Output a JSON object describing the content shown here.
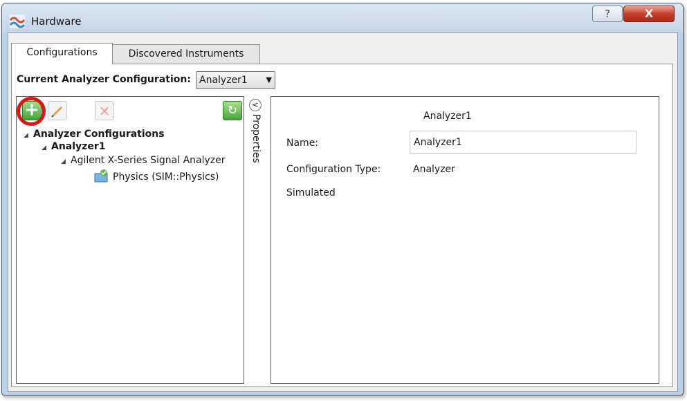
{
  "window": {
    "title": "Hardware",
    "help": "?",
    "close": "X"
  },
  "tabs": [
    {
      "label": "Configurations",
      "active": true
    },
    {
      "label": "Discovered Instruments",
      "active": false
    }
  ],
  "config": {
    "label": "Current Analyzer Configuration:",
    "selected": "Analyzer1"
  },
  "toolbar": {
    "add": "+",
    "delete": "×",
    "refresh": "↻"
  },
  "tree": {
    "root": "Analyzer Configurations",
    "child": "Analyzer1",
    "instrument": "Agilent X-Series Signal Analyzer",
    "sim": "Physics (SIM::Physics)"
  },
  "splitter": {
    "label": "Properties",
    "collapse": "<"
  },
  "properties": {
    "header": "Analyzer1",
    "name_label": "Name:",
    "name_value": "Analyzer1",
    "type_label": "Configuration Type:",
    "type_value": "Analyzer",
    "simulated_label": "Simulated"
  }
}
